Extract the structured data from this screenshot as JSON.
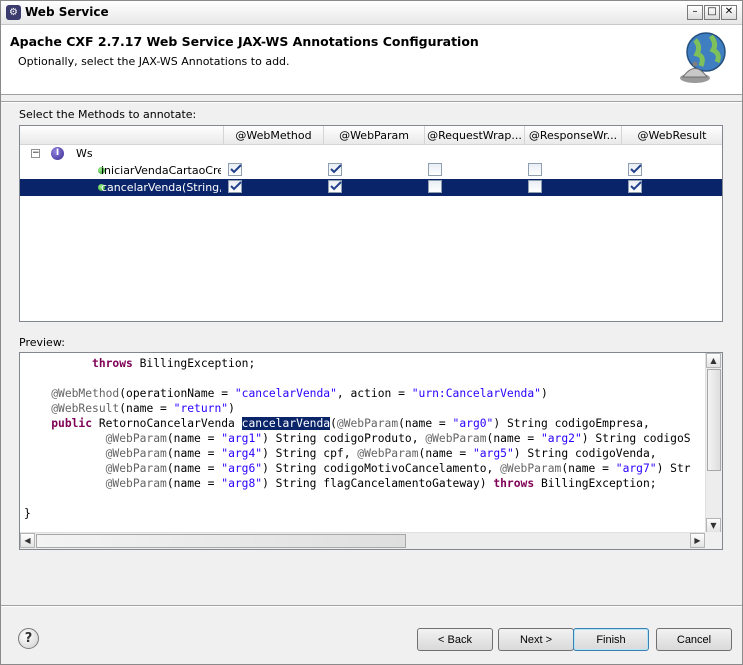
{
  "window": {
    "title": "Web Service"
  },
  "header": {
    "title": "Apache CXF 2.7.17 Web Service JAX-WS Annotations Configuration",
    "description": "Optionally, select the JAX-WS Annotations to add."
  },
  "methods": {
    "label": "Select the Methods to annotate:",
    "columns": [
      "",
      "@WebMethod",
      "@WebParam",
      "@RequestWrap...",
      "@ResponseWr...",
      "@WebResult"
    ],
    "root": "Ws",
    "rows": [
      {
        "name": "iniciarVendaCartaoCredito",
        "checks": [
          true,
          true,
          false,
          false,
          true
        ],
        "selected": false
      },
      {
        "name": "cancelarVenda(String, Str",
        "checks": [
          true,
          true,
          false,
          false,
          true
        ],
        "selected": true
      }
    ]
  },
  "preview": {
    "label": "Preview:",
    "l1_kw": "throws",
    "l1_rest": " BillingException;",
    "l2_ann": "@WebMethod",
    "l2_a": "(operationName = ",
    "l2_s1": "\"cancelarVenda\"",
    "l2_b": ", action = ",
    "l2_s2": "\"urn:CancelarVenda\"",
    "l2_c": ")",
    "l3_ann": "@WebResult",
    "l3_a": "(name = ",
    "l3_s1": "\"return\"",
    "l3_c": ")",
    "l4_kw": "public",
    "l4_a": " RetornoCancelarVenda ",
    "l4_hl": "cancelarVenda",
    "l4_b": "(",
    "l4_ann": "@WebParam",
    "l4_c": "(name = ",
    "l4_s1": "\"arg0\"",
    "l4_d": ") String codigoEmpresa,",
    "l5_ann1": "@WebParam",
    "l5_a": "(name = ",
    "l5_s1": "\"arg1\"",
    "l5_b": ") String codigoProduto, ",
    "l5_ann2": "@WebParam",
    "l5_c": "(name = ",
    "l5_s2": "\"arg2\"",
    "l5_d": ") String codigoS",
    "l6_ann1": "@WebParam",
    "l6_a": "(name = ",
    "l6_s1": "\"arg4\"",
    "l6_b": ") String cpf, ",
    "l6_ann2": "@WebParam",
    "l6_c": "(name = ",
    "l6_s2": "\"arg5\"",
    "l6_d": ") String codigoVenda,",
    "l7_ann1": "@WebParam",
    "l7_a": "(name = ",
    "l7_s1": "\"arg6\"",
    "l7_b": ") String codigoMotivoCancelamento, ",
    "l7_ann2": "@WebParam",
    "l7_c": "(name = ",
    "l7_s2": "\"arg7\"",
    "l7_d": ") Str",
    "l8_ann": "@WebParam",
    "l8_a": "(name = ",
    "l8_s1": "\"arg8\"",
    "l8_b": ") String flagCancelamentoGateway) ",
    "l8_kw": "throws",
    "l8_c": " BillingException;",
    "l9": "}"
  },
  "buttons": {
    "back": "< Back",
    "next": "Next >",
    "finish": "Finish",
    "cancel": "Cancel"
  },
  "colors": {
    "selection": "#0a246a",
    "keyword": "#7f0055",
    "string": "#2a00ff",
    "annotation": "#646464"
  },
  "icons": [
    "app-icon",
    "minimize-icon",
    "maximize-icon",
    "close-icon",
    "globe-wizard-icon",
    "collapse-icon",
    "info-icon",
    "method-dot-icon",
    "help-icon"
  ]
}
